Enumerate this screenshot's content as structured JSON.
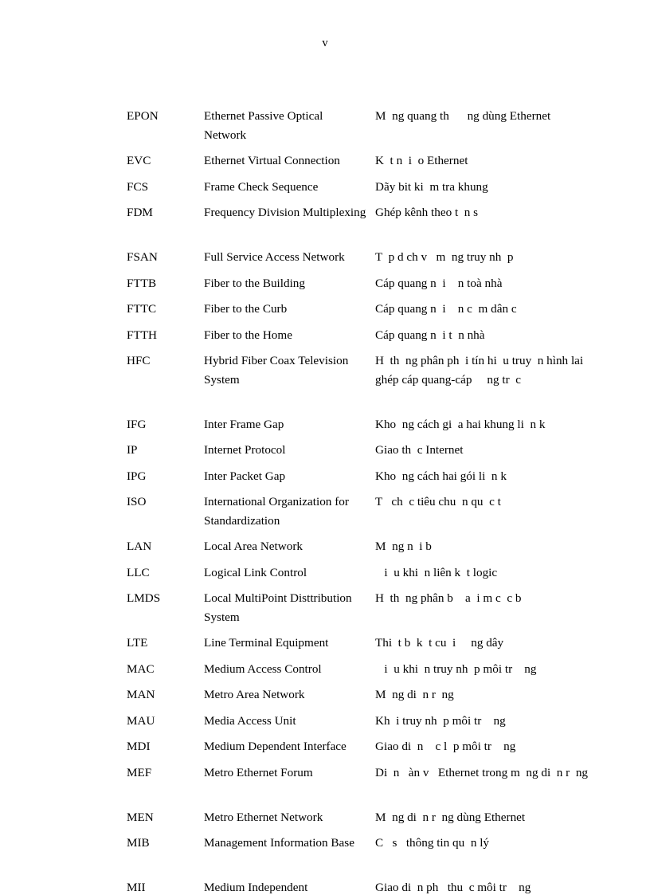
{
  "page": {
    "number": "v",
    "type": "abbreviations-glossary"
  },
  "glossary": {
    "entries": [
      {
        "abbr": "EPON",
        "english": "Ethernet Passive Optical Network",
        "vietnamese": "M  ng quang th      ng dùng Ethernet",
        "lines": 2
      },
      {
        "abbr": "EVC",
        "english": "Ethernet Virtual Connection",
        "vietnamese": "K  t n  i  o Ethernet",
        "lines": 1
      },
      {
        "abbr": "FCS",
        "english": "Frame Check Sequence",
        "vietnamese": "Dãy bit ki  m tra khung",
        "lines": 1
      },
      {
        "abbr": "FDM",
        "english": "Frequency Division Multiplexing",
        "vietnamese": "Ghép kênh theo t  n s",
        "lines": 2
      },
      {
        "abbr": "FSAN",
        "english": "Full Service Access Network",
        "vietnamese": "T  p d ch v   m  ng truy nh  p",
        "lines": 1
      },
      {
        "abbr": "FTTB",
        "english": "Fiber to the Building",
        "vietnamese": "Cáp quang n  i    n toà nhà",
        "lines": 1
      },
      {
        "abbr": "FTTC",
        "english": "Fiber to the Curb",
        "vietnamese": "Cáp quang n  i    n c  m dân c",
        "lines": 1
      },
      {
        "abbr": "FTTH",
        "english": "Fiber to the Home",
        "vietnamese": "Cáp quang n  i t  n nhà",
        "lines": 1
      },
      {
        "abbr": "HFC",
        "english": "Hybrid Fiber Coax Television System",
        "vietnamese": "H  th  ng phân ph  i tín hi  u truy  n hình lai ghép cáp quang-cáp     ng tr  c",
        "lines": 3
      },
      {
        "abbr": "IFG",
        "english": "Inter Frame Gap",
        "vietnamese": "Kho  ng cách gi  a hai khung li  n k",
        "lines": 1
      },
      {
        "abbr": "IP",
        "english": "Internet Protocol",
        "vietnamese": "Giao th  c Internet",
        "lines": 1
      },
      {
        "abbr": "IPG",
        "english": "Inter Packet Gap",
        "vietnamese": "Kho  ng cách hai gói li  n k",
        "lines": 1
      },
      {
        "abbr": "ISO",
        "english": "International Organization for Standardization",
        "vietnamese": "T   ch  c tiêu chu  n qu  c t",
        "lines": 2
      },
      {
        "abbr": "LAN",
        "english": "Local Area Network",
        "vietnamese": "M  ng n  i b",
        "lines": 1
      },
      {
        "abbr": "LLC",
        "english": "Logical Link Control",
        "vietnamese": "   i  u khi  n liên k  t logic",
        "lines": 1
      },
      {
        "abbr": "LMDS",
        "english": "Local MultiPoint Disttribution System",
        "vietnamese": "H  th  ng phân b    a  i m c  c b",
        "lines": 2
      },
      {
        "abbr": "LTE",
        "english": "Line Terminal Equipment",
        "vietnamese": "Thi  t b  k  t cu  i     ng dây",
        "lines": 1
      },
      {
        "abbr": "MAC",
        "english": "Medium Access Control",
        "vietnamese": "   i  u khi  n truy nh  p môi tr    ng",
        "lines": 1
      },
      {
        "abbr": "MAN",
        "english": "Metro Area Network",
        "vietnamese": "M  ng di  n r  ng",
        "lines": 1
      },
      {
        "abbr": "MAU",
        "english": "Media Access Unit",
        "vietnamese": "Kh  i truy nh  p môi tr    ng",
        "lines": 1
      },
      {
        "abbr": "MDI",
        "english": "Medium Dependent Interface",
        "vietnamese": "Giao di  n    c l  p môi tr    ng",
        "lines": 1
      },
      {
        "abbr": "MEF",
        "english": "Metro Ethernet Forum",
        "vietnamese": "Di  n   àn v   Ethernet trong m  ng di  n r  ng",
        "lines": 2
      },
      {
        "abbr": "MEN",
        "english": "Metro Ethernet Network",
        "vietnamese": "M  ng di  n r  ng dùng Ethernet",
        "lines": 1
      },
      {
        "abbr": "MIB",
        "english": "Management Information Base",
        "vietnamese": "C   s   thông tin qu  n lý",
        "lines": 2
      },
      {
        "abbr": "MII",
        "english": "Medium Independent",
        "vietnamese": "Giao di  n ph   thu  c môi tr    ng",
        "lines": 1
      }
    ]
  }
}
